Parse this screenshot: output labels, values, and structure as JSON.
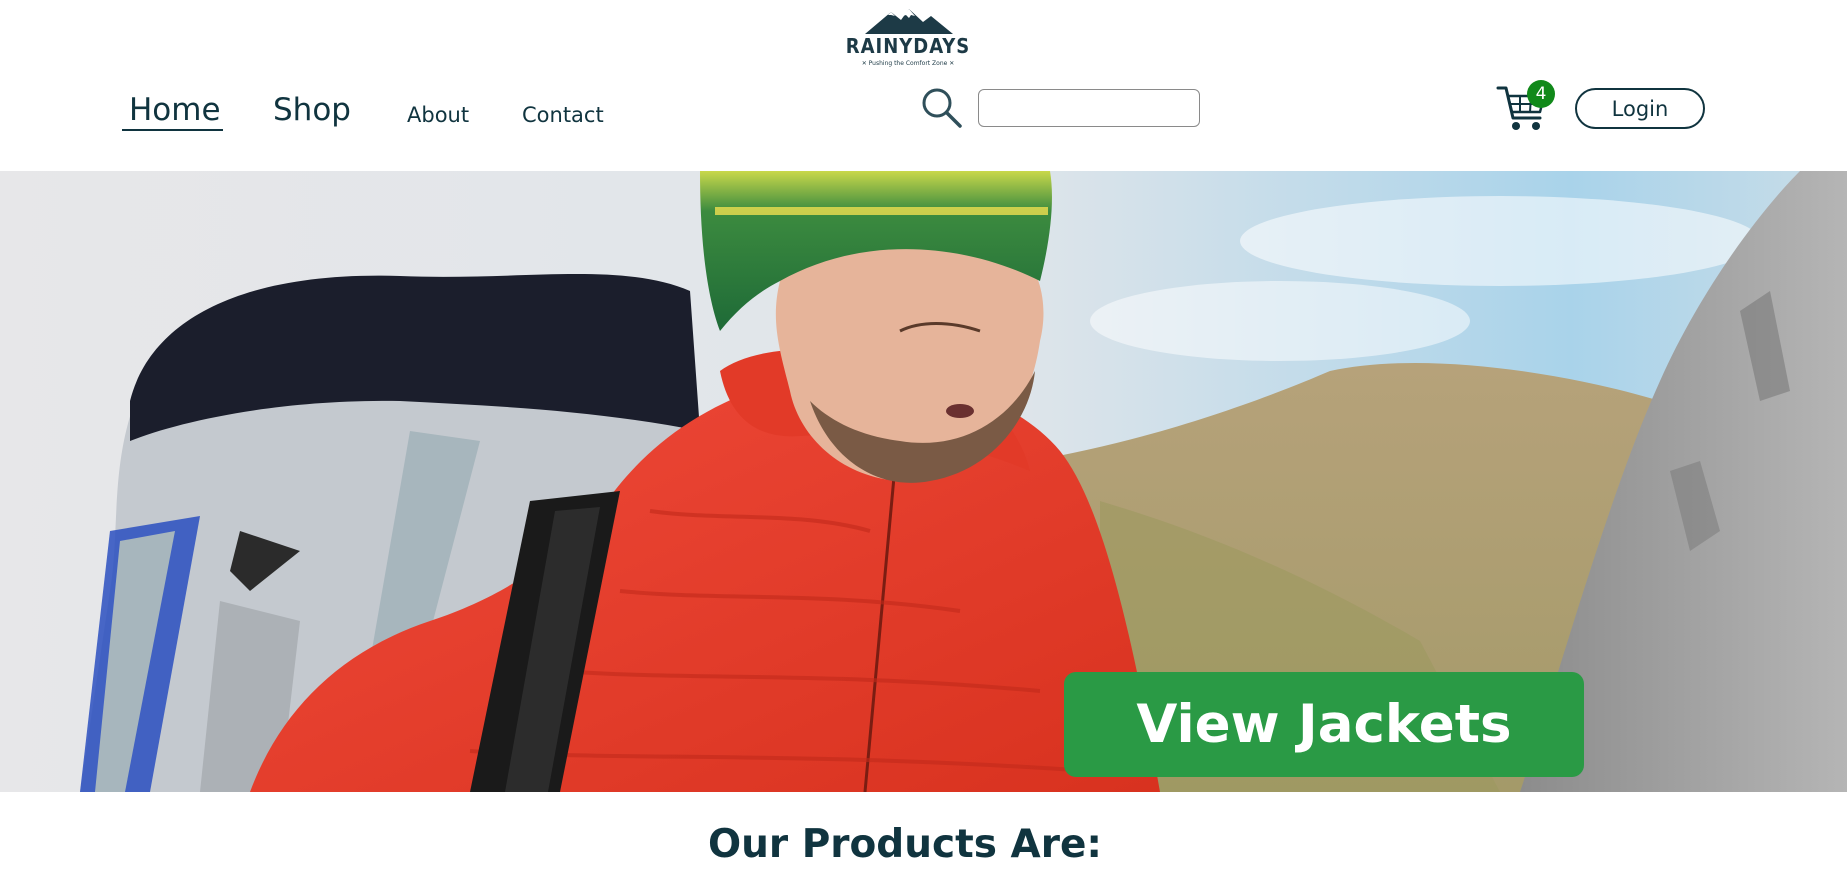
{
  "brand": {
    "name": "RAINYDAYS",
    "tagline": "✕ Pushing the Comfort Zone ✕",
    "logo_icon": "mountain-icon",
    "primary_color": "#10343f",
    "accent_color": "#2a9a45"
  },
  "nav": {
    "items": [
      {
        "label": "Home",
        "active": true
      },
      {
        "label": "Shop"
      },
      {
        "label": "About"
      },
      {
        "label": "Contact"
      }
    ]
  },
  "search": {
    "icon": "search-icon",
    "value": "",
    "placeholder": ""
  },
  "cart": {
    "icon": "cart-icon",
    "count": "4",
    "badge_color": "#11891a"
  },
  "auth": {
    "login_label": "Login"
  },
  "hero": {
    "cta_label": "View Jackets"
  },
  "products": {
    "heading": "Our Products Are:"
  }
}
